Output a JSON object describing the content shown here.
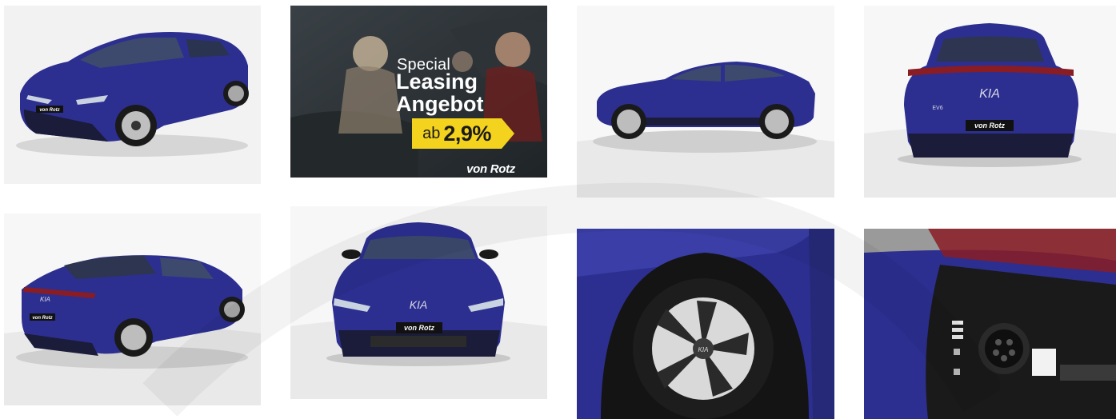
{
  "gallery": {
    "tiles": [
      {
        "id": 1,
        "subject": "front-left-three-quarter"
      },
      {
        "id": 2,
        "subject": "promo-banner"
      },
      {
        "id": 3,
        "subject": "side-profile"
      },
      {
        "id": 4,
        "subject": "rear"
      },
      {
        "id": 5,
        "subject": "rear-left-three-quarter"
      },
      {
        "id": 6,
        "subject": "front"
      },
      {
        "id": 7,
        "subject": "wheel-closeup"
      },
      {
        "id": 8,
        "subject": "charging-port-closeup"
      }
    ]
  },
  "promo": {
    "special": "Special",
    "leasing": "Leasing",
    "angebot": "Angebot",
    "ab": "ab",
    "rate": "2,9%",
    "brand": "von Rotz"
  },
  "plates": {
    "brand": "von Rotz"
  },
  "badges": {
    "kia_logo": "KIA",
    "model": "EV6"
  },
  "colors": {
    "car_blue": "#2c2f8f",
    "car_blue_dark": "#1c1e5e",
    "badge_yellow": "#f4d31e",
    "promo_bg": "#2b3136"
  }
}
